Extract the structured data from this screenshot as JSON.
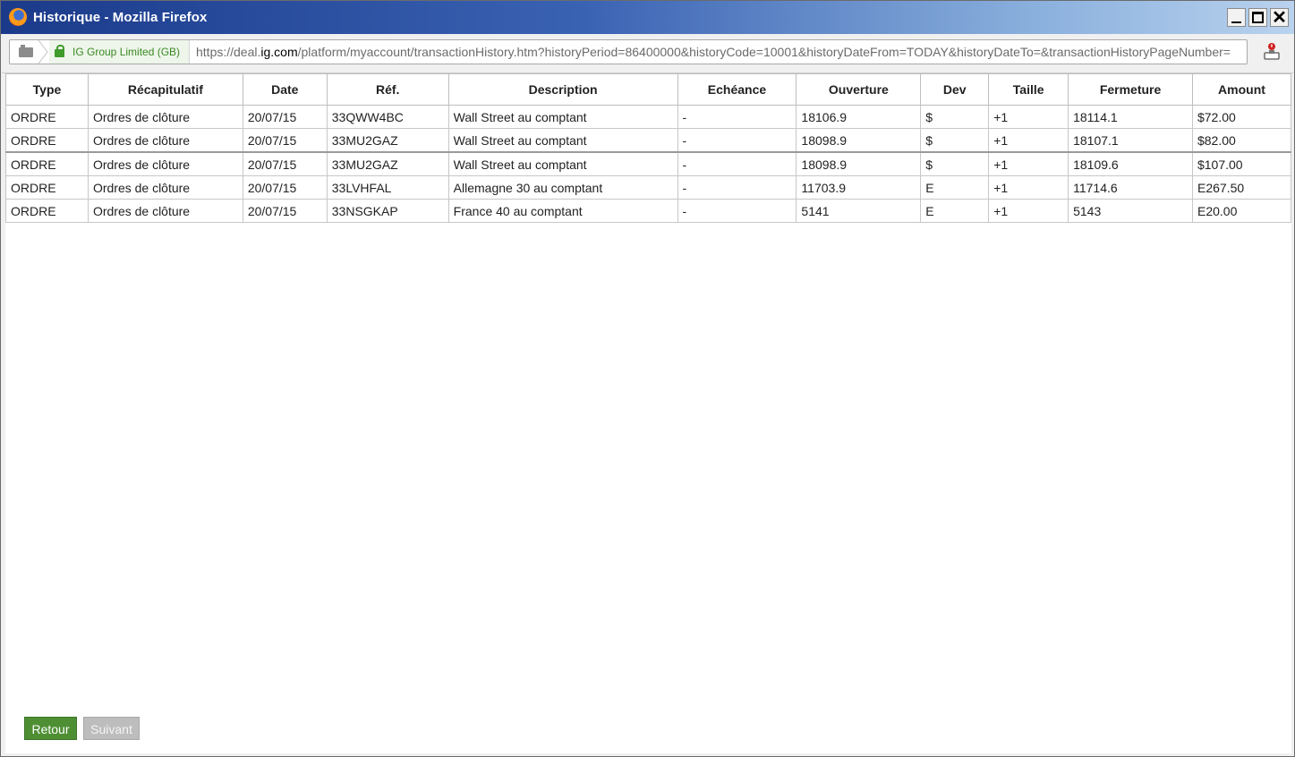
{
  "window": {
    "title": "Historique - Mozilla Firefox"
  },
  "navbar": {
    "identity_label": "IG Group Limited (GB)",
    "url_prefix": "https://deal.",
    "url_domain": "ig.com",
    "url_suffix": "/platform/myaccount/transactionHistory.htm?historyPeriod=86400000&historyCode=10001&historyDateFrom=TODAY&historyDateTo=&transactionHistoryPageNumber="
  },
  "table": {
    "headers": [
      "Type",
      "Récapitulatif",
      "Date",
      "Réf.",
      "Description",
      "Echéance",
      "Ouverture",
      "Dev",
      "Taille",
      "Fermeture",
      "Amount"
    ],
    "rows": [
      [
        "ORDRE",
        "Ordres de clôture",
        "20/07/15",
        "33QWW4BC",
        "Wall Street au comptant",
        "-",
        "18106.9",
        "$",
        "+1",
        "18114.1",
        "$72.00"
      ],
      [
        "ORDRE",
        "Ordres de clôture",
        "20/07/15",
        "33MU2GAZ",
        "Wall Street au comptant",
        "-",
        "18098.9",
        "$",
        "+1",
        "18107.1",
        "$82.00"
      ],
      [
        "ORDRE",
        "Ordres de clôture",
        "20/07/15",
        "33MU2GAZ",
        "Wall Street au comptant",
        "-",
        "18098.9",
        "$",
        "+1",
        "18109.6",
        "$107.00"
      ],
      [
        "ORDRE",
        "Ordres de clôture",
        "20/07/15",
        "33LVHFAL",
        "Allemagne 30 au comptant",
        "-",
        "11703.9",
        "E",
        "+1",
        "11714.6",
        "E267.50"
      ],
      [
        "ORDRE",
        "Ordres de clôture",
        "20/07/15",
        "33NSGKAP",
        "France 40 au comptant",
        "-",
        "5141",
        "E",
        "+1",
        "5143",
        "E20.00"
      ]
    ]
  },
  "buttons": {
    "back_label": "Retour",
    "next_label": "Suivant"
  },
  "colors": {
    "back_button": "#4e8f34",
    "next_button_disabled": "#bdbdbd",
    "identity_green": "#3a8a24"
  }
}
